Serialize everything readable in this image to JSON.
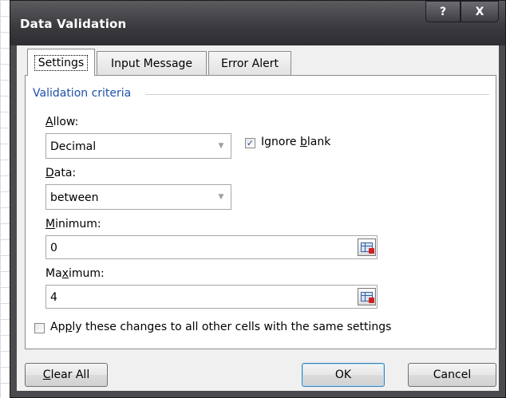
{
  "window": {
    "title": "Data Validation",
    "help_glyph": "?",
    "close_glyph": "X"
  },
  "tabs": [
    {
      "label": "Settings",
      "active": true
    },
    {
      "label": "Input Message",
      "active": false
    },
    {
      "label": "Error Alert",
      "active": false
    }
  ],
  "settings": {
    "group_title": "Validation criteria",
    "allow": {
      "label_underlined": "A",
      "label_rest": "llow:",
      "value": "Decimal"
    },
    "ignore_blank": {
      "checked": true,
      "check_glyph": "✓",
      "label_pre": "Ignore ",
      "label_underlined": "b",
      "label_post": "lank"
    },
    "data": {
      "label_underlined": "D",
      "label_rest": "ata:",
      "value": "between"
    },
    "minimum": {
      "label_underlined": "M",
      "label_rest": "inimum:",
      "value": "0"
    },
    "maximum": {
      "label_pre": "Ma",
      "label_underlined": "x",
      "label_post": "imum:",
      "value": "4"
    },
    "apply_all": {
      "checked": false,
      "label_pre": "Ap",
      "label_underlined": "p",
      "label_post": "ly these changes to all other cells with the same settings"
    }
  },
  "buttons": {
    "clear_all": {
      "underlined": "C",
      "rest": "lear All"
    },
    "ok": "OK",
    "cancel": "Cancel"
  },
  "icons": {
    "combo_arrow": "▼"
  }
}
